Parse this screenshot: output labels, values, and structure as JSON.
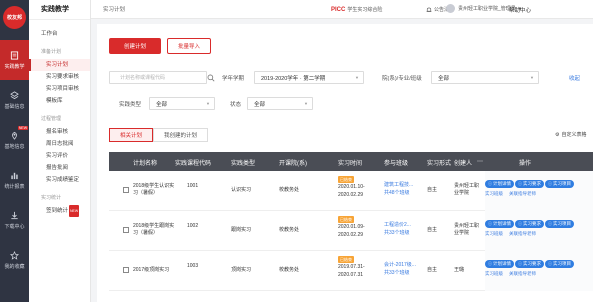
{
  "app": {
    "logo": "校友邦",
    "nav_title": "实践教学"
  },
  "rail": [
    {
      "label": "实践教学",
      "icon": "book-icon",
      "active": true
    },
    {
      "label": "基础信息",
      "icon": "layers-icon",
      "active": false
    },
    {
      "label": "基地信息",
      "icon": "map-pin-icon",
      "active": false,
      "badge": "NEW"
    },
    {
      "label": "统计报表",
      "icon": "bar-chart-icon",
      "active": false
    },
    {
      "label": "下载中心",
      "icon": "download-icon",
      "active": false
    },
    {
      "label": "我的收藏",
      "icon": "star-icon",
      "active": false
    }
  ],
  "nav": {
    "top": "工作台",
    "groups": [
      {
        "title": "准备计划",
        "items": [
          {
            "label": "实习计划",
            "active": true
          },
          {
            "label": "实习要求审核"
          },
          {
            "label": "实习项目审核"
          },
          {
            "label": "模板库"
          }
        ]
      },
      {
        "title": "过程管理",
        "items": [
          {
            "label": "报名审核"
          },
          {
            "label": "周日志批阅"
          },
          {
            "label": "实习评价"
          },
          {
            "label": "报告批阅"
          },
          {
            "label": "实习成绩鉴定"
          }
        ]
      },
      {
        "title": "实习统计",
        "items": [
          {
            "label": "签到统计",
            "badge": "NEW"
          }
        ]
      }
    ]
  },
  "topbar": {
    "breadcrumb": "实习计划",
    "brand": "PICC",
    "brand_sub": "学生实习综合险",
    "notice": "公告消息",
    "user": "贵州轻工职业学院_管理员",
    "help": "帮助中心"
  },
  "toolbar": {
    "create": "创建计划",
    "import": "批量导入"
  },
  "filters": {
    "search_placeholder": "计划名称或课程代码",
    "term_label": "学年学期",
    "term_value": "2019-2020学年 · 第二学期",
    "dept_label": "院(系)/专业/班级",
    "dept_value": "全部",
    "fold": "收起",
    "type_label": "实践类型",
    "type_value": "全部",
    "status_label": "状态",
    "status_value": "全部"
  },
  "tabs": {
    "related": "相关计划",
    "mine": "我创建的计划",
    "custom": "自定义表格"
  },
  "table": {
    "headers": [
      "计划名称",
      "实践课程代码",
      "实践类型",
      "开课院(系)",
      "实习时间",
      "参与班级",
      "实习形式",
      "创建人",
      "操作"
    ],
    "rows": [
      {
        "name": "2018级学生认识实习（暑假）",
        "code": "1001",
        "type": "认识实习",
        "dept": "校教务处",
        "badge": "已结束",
        "start": "2020.01.10-",
        "end": "2020.02.29",
        "cls": "建筑工程技...",
        "cls_count": "共48个班级",
        "form": "自主",
        "creator": "贵州轻工职业学院"
      },
      {
        "name": "2018级学生跟岗实习（暑假）",
        "code": "1002",
        "type": "跟岗实习",
        "dept": "校教务处",
        "badge": "已结束",
        "start": "2020.01.09-",
        "end": "2020.02.29",
        "cls": "工程造价2...",
        "cls_count": "共33个班级",
        "form": "自主",
        "creator": "贵州轻工职业学院"
      },
      {
        "name": "2017级顶岗实习",
        "code": "1003",
        "type": "顶岗实习",
        "dept": "校教务处",
        "badge": "已结束",
        "start": "2019.07.31-",
        "end": "2020.07.31",
        "cls": "会计-2017级...",
        "cls_count": "共33个班级",
        "form": "自主",
        "creator": "王璐"
      }
    ],
    "ops": {
      "detail": "计划详情",
      "req": "实习要求",
      "proj": "实习项目",
      "manage": "实习班级",
      "teacher": "关联指导老师"
    }
  }
}
